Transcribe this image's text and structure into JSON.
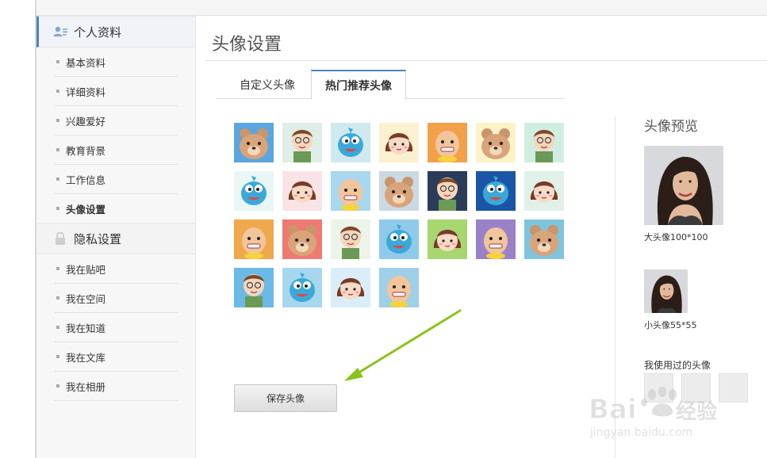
{
  "sidebar": {
    "profile_section": {
      "label": "个人资料",
      "icon": "user-card-icon"
    },
    "profile_items": [
      {
        "label": "基本资料",
        "active": false
      },
      {
        "label": "详细资料",
        "active": false
      },
      {
        "label": "兴趣爱好",
        "active": false
      },
      {
        "label": "教育背景",
        "active": false
      },
      {
        "label": "工作信息",
        "active": false
      },
      {
        "label": "头像设置",
        "active": true
      }
    ],
    "privacy_section": {
      "label": "隐私设置",
      "icon": "lock-icon"
    },
    "privacy_items": [
      {
        "label": "我在贴吧"
      },
      {
        "label": "我在空间"
      },
      {
        "label": "我在知道"
      },
      {
        "label": "我在文库"
      },
      {
        "label": "我在相册"
      }
    ]
  },
  "main": {
    "title": "头像设置",
    "tabs": [
      {
        "label": "自定义头像",
        "active": false
      },
      {
        "label": "热门推荐头像",
        "active": true
      }
    ],
    "avatars": [
      {
        "kind": "bear",
        "bg": "#5aa6e0"
      },
      {
        "kind": "boy",
        "bg": "#dfeee6"
      },
      {
        "kind": "blue",
        "bg": "#cfe9ef"
      },
      {
        "kind": "girl",
        "bg": "#fbf0d0"
      },
      {
        "kind": "bald",
        "bg": "#f2a14a"
      },
      {
        "kind": "bear",
        "bg": "#fbf2c8"
      },
      {
        "kind": "boy",
        "bg": "#cfeee0"
      },
      {
        "kind": "blue",
        "bg": "#e9f6f4"
      },
      {
        "kind": "girl",
        "bg": "#f9e3e6"
      },
      {
        "kind": "bald",
        "bg": "#a8d7ee"
      },
      {
        "kind": "bear",
        "bg": "#cbd9e4"
      },
      {
        "kind": "boy",
        "bg": "#2a3c5a"
      },
      {
        "kind": "blue",
        "bg": "#1b56a6"
      },
      {
        "kind": "girl",
        "bg": "#dff1e8"
      },
      {
        "kind": "bald",
        "bg": "#f0a84c"
      },
      {
        "kind": "bear",
        "bg": "#ef7a72"
      },
      {
        "kind": "boy",
        "bg": "#ecf3e9"
      },
      {
        "kind": "blue",
        "bg": "#8fcaea"
      },
      {
        "kind": "girl",
        "bg": "#a8d670"
      },
      {
        "kind": "bald",
        "bg": "#9a82c8"
      },
      {
        "kind": "bear",
        "bg": "#7fc4dd"
      },
      {
        "kind": "boy",
        "bg": "#6ab9e6"
      },
      {
        "kind": "blue",
        "bg": "#a7d6ef"
      },
      {
        "kind": "girl",
        "bg": "#d9eef8"
      },
      {
        "kind": "bald",
        "bg": "#9fcfe9"
      }
    ],
    "save_button": "保存头像"
  },
  "preview": {
    "title": "头像预览",
    "big_caption": "大头像100*100",
    "small_caption": "小头像55*55",
    "used_label": "我使用过的头像"
  },
  "watermark": {
    "text": "Bai 经验",
    "url": "jingyan.baidu.com"
  },
  "colors": {
    "accent": "#4b84c4",
    "arrow": "#8cc21e"
  }
}
